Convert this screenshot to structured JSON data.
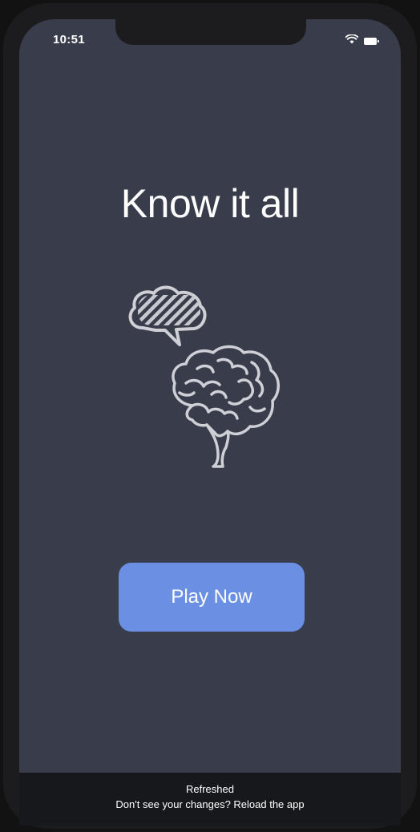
{
  "status_bar": {
    "time": "10:51",
    "icons": [
      "wifi-icon",
      "battery-icon"
    ]
  },
  "main": {
    "title": "Know it all",
    "illustration": [
      "speech-bubble-icon",
      "brain-icon"
    ],
    "play_button_label": "Play Now"
  },
  "toast": {
    "title": "Refreshed",
    "message": "Don't see your changes? Reload the app"
  },
  "colors": {
    "background": "#393c4b",
    "button": "#6a8fe3",
    "toast_background": "#17181c",
    "text": "#ffffff"
  }
}
